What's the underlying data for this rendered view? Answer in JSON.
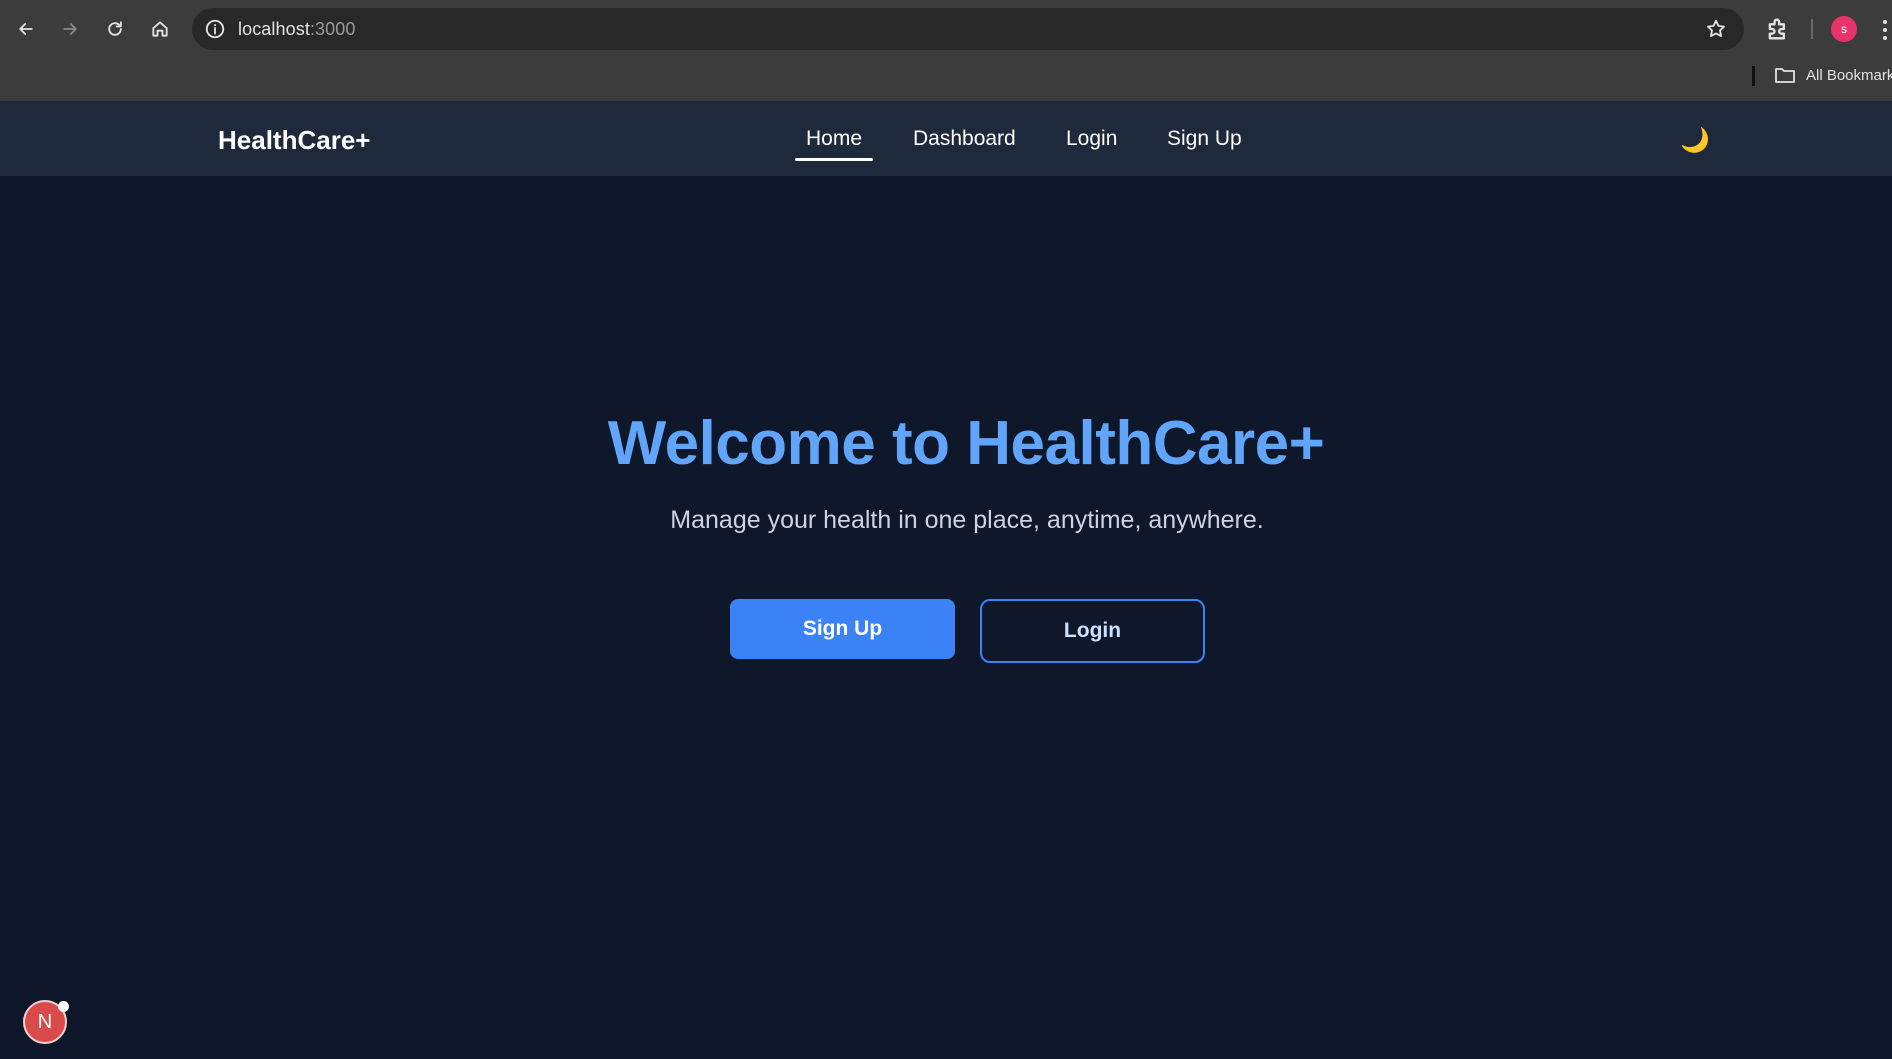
{
  "browser": {
    "url_host": "localhost",
    "url_port": ":3000",
    "profile_initial": "s",
    "bookmarks_label": "All Bookmarks"
  },
  "app": {
    "brand": "HealthCare+",
    "nav": [
      {
        "label": "Home",
        "active": true
      },
      {
        "label": "Dashboard",
        "active": false
      },
      {
        "label": "Login",
        "active": false
      },
      {
        "label": "Sign Up",
        "active": false
      }
    ],
    "theme_toggle_icon": "moon-icon",
    "theme_toggle_glyph": "🌙"
  },
  "hero": {
    "title": "Welcome to HealthCare+",
    "subtitle": "Manage your health in one place, anytime, anywhere.",
    "primary_cta": "Sign Up",
    "secondary_cta": "Login"
  },
  "dev_badge": {
    "letter": "N"
  },
  "colors": {
    "page_bg": "#0f172a",
    "nav_bg": "#1e293b",
    "accent": "#3b82f6",
    "title": "#60a5fa"
  }
}
